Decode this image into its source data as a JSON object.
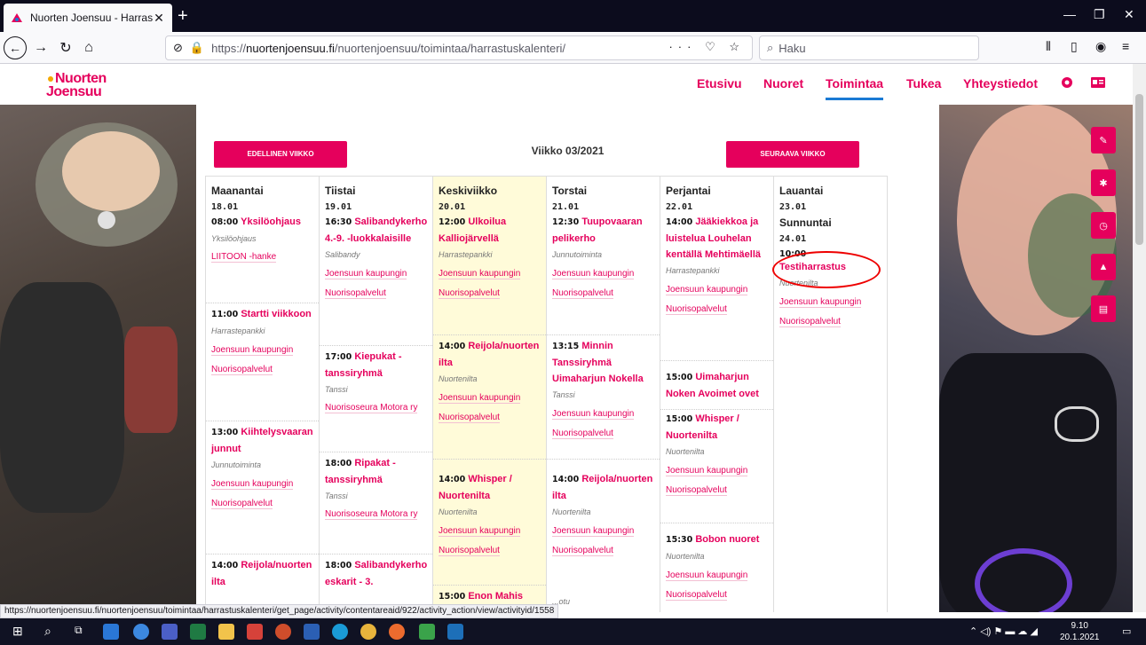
{
  "browser": {
    "tab_title": "Nuorten Joensuu - Harrastuskal",
    "tab_close": "✕",
    "new_tab": "+",
    "url_prefix": "https://",
    "url_host": "nuortenjoensuu.fi",
    "url_path": "/nuortenjoensuu/toimintaa/harrastuskalenteri/",
    "search_placeholder": "Haku",
    "status_url": "https://nuortenjoensuu.fi/nuortenjoensuu/toimintaa/harrastuskalenteri/get_page/activity/contentareaid/922/activity_action/view/activityid/1558"
  },
  "site": {
    "logo_line1": "Nuorten",
    "logo_line2": "Joensuu",
    "menu": [
      "Etusivu",
      "Nuoret",
      "Toimintaa",
      "Tukea",
      "Yhteystiedot"
    ],
    "active_menu": "Toimintaa",
    "brand_color": "#e5005c"
  },
  "calendar": {
    "prev_label": "EDELLINEN VIIKKO",
    "next_label": "SEURAAVA VIIKKO",
    "week_title": "Viikko 03/2021",
    "days": [
      {
        "name": "Maanantai",
        "date": "18.01",
        "events": [
          {
            "time": "08:00",
            "title": "Yksilöohjaus",
            "category": "Yksilöohjaus",
            "org": "LIITOON -hanke"
          },
          {
            "time": "11:00",
            "title": "Startti viikkoon",
            "category": "Harrastepankki",
            "org": "Joensuun kaupungin Nuorisopalvelut"
          },
          {
            "time": "13:00",
            "title": "Kiihtelysvaaran junnut",
            "category": "Junnutoiminta",
            "org": "Joensuun kaupungin Nuorisopalvelut"
          },
          {
            "time": "14:00",
            "title": "Reijola/nuorten ilta",
            "category": "",
            "org": ""
          }
        ]
      },
      {
        "name": "Tiistai",
        "date": "19.01",
        "events": [
          {
            "time": "16:30",
            "title": "Salibandykerho 4.-9. -luokkalaisille",
            "category": "Salibandy",
            "org": "Joensuun kaupungin Nuorisopalvelut"
          },
          {
            "time": "17:00",
            "title": "Kiepukat -tanssiryhmä",
            "category": "Tanssi",
            "org": "Nuorisoseura Motora ry"
          },
          {
            "time": "18:00",
            "title": "Ripakat - tanssiryhmä",
            "category": "Tanssi",
            "org": "Nuorisoseura Motora ry"
          },
          {
            "time": "18:00",
            "title": "Salibandykerho eskarit - 3.",
            "category": "",
            "org": ""
          }
        ]
      },
      {
        "name": "Keskiviikko",
        "date": "20.01",
        "events": [
          {
            "time": "12:00",
            "title": "Ulkoilua Kalliojärvellä",
            "category": "Harrastepankki",
            "org": "Joensuun kaupungin Nuorisopalvelut"
          },
          {
            "time": "14:00",
            "title": "Reijola/nuorten ilta",
            "category": "Nuortenilta",
            "org": "Joensuun kaupungin Nuorisopalvelut"
          },
          {
            "time": "14:00",
            "title": "Whisper / Nuortenilta",
            "category": "Nuortenilta",
            "org": "Joensuun kaupungin Nuorisopalvelut"
          },
          {
            "time": "15:00",
            "title": "Enon Mahis",
            "category": "",
            "org": ""
          }
        ]
      },
      {
        "name": "Torstai",
        "date": "21.01",
        "events": [
          {
            "time": "12:30",
            "title": "Tuupovaaran pelikerho",
            "category": "Junnutoiminta",
            "org": "Joensuun kaupungin Nuorisopalvelut"
          },
          {
            "time": "13:15",
            "title": "Minnin Tanssiryhmä Uimaharjun Nokella",
            "category": "Tanssi",
            "org": "Joensuun kaupungin Nuorisopalvelut"
          },
          {
            "time": "14:00",
            "title": "Reijola/nuorten ilta",
            "category": "Nuortenilta",
            "org": "Joensuun kaupungin Nuorisopalvelut"
          },
          {
            "time": "",
            "title": "",
            "category": "...otu",
            "org": ""
          }
        ]
      },
      {
        "name": "Perjantai",
        "date": "22.01",
        "events": [
          {
            "time": "14:00",
            "title": "Jääkiekkoa ja luistelua Louhelan kentällä Mehtimäellä",
            "category": "Harrastepankki",
            "org": "Joensuun kaupungin Nuorisopalvelut"
          },
          {
            "time": "15:00",
            "title": "Uimaharjun Noken Avoimet ovet",
            "category": "",
            "org": ""
          },
          {
            "time": "15:00",
            "title": "Whisper / Nuortenilta",
            "category": "Nuortenilta",
            "org": "Joensuun kaupungin Nuorisopalvelut"
          },
          {
            "time": "15:30",
            "title": "Bobon nuoret",
            "category": "Nuortenilta",
            "org": "Joensuun kaupungin Nuorisopalvelut"
          }
        ]
      },
      {
        "name": "Lauantai",
        "date": "23.01",
        "name2": "Sunnuntai",
        "date2": "24.01",
        "events": [
          {
            "time": "10:00",
            "title": "Testiharrastus",
            "category": "Nuortenilta",
            "org": "Joensuun kaupungin Nuorisopalvelut"
          }
        ]
      }
    ]
  },
  "taskbar": {
    "clock_time": "9.10",
    "clock_date": "20.1.2021"
  }
}
